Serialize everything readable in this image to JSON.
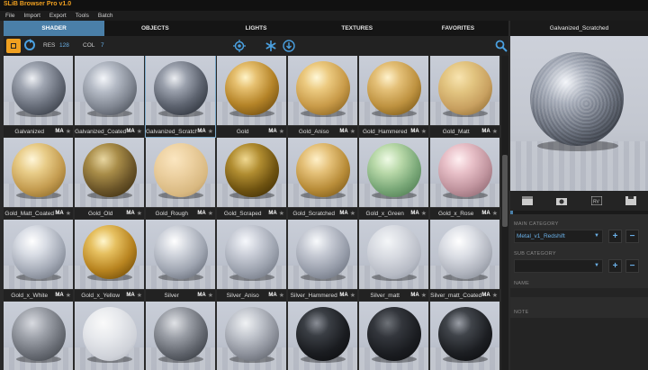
{
  "app": {
    "title": "SLiB Browser Pro v1.0"
  },
  "menu": [
    "File",
    "Import",
    "Export",
    "Tools",
    "Batch"
  ],
  "tabs": [
    {
      "label": "SHADER",
      "active": true
    },
    {
      "label": "OBJECTS",
      "active": false
    },
    {
      "label": "LIGHTS",
      "active": false
    },
    {
      "label": "TEXTURES",
      "active": false
    },
    {
      "label": "FAVORITES",
      "active": false
    }
  ],
  "toolbar": {
    "res_label": "RES",
    "res_value": "128",
    "col_label": "COL",
    "col_value": "7"
  },
  "tag": "MA",
  "colors": {
    "accent": "#4a7fa8",
    "orange": "#f0a020",
    "blue_text": "#6ab0e8"
  },
  "icons": [
    "grid-icon",
    "refresh-icon",
    "target-icon",
    "snowflake-icon",
    "download-icon",
    "search-icon",
    "clapper-icon",
    "camera-icon",
    "rv-icon",
    "save-icon"
  ],
  "shaders": [
    {
      "name": "Galvanized",
      "mat": "galv"
    },
    {
      "name": "Galvanized_Coated",
      "mat": "galv2"
    },
    {
      "name": "Galvanized_Scratched",
      "mat": "galv3",
      "selected": true
    },
    {
      "name": "Gold",
      "mat": "gold"
    },
    {
      "name": "Gold_Aniso",
      "mat": "goldaniso"
    },
    {
      "name": "Gold_Hammered",
      "mat": "goldham"
    },
    {
      "name": "Gold_Matt",
      "mat": "goldmatt"
    },
    {
      "name": "Gold_Matt_Coated",
      "mat": "goldmattc"
    },
    {
      "name": "Gold_Old",
      "mat": "goldold"
    },
    {
      "name": "Gold_Rough",
      "mat": "goldrough"
    },
    {
      "name": "Gold_Scraped",
      "mat": "goldscr"
    },
    {
      "name": "Gold_Scratched",
      "mat": "goldscr2"
    },
    {
      "name": "Gold_x_Green",
      "mat": "green"
    },
    {
      "name": "Gold_x_Rose",
      "mat": "rose"
    },
    {
      "name": "Gold_x_White",
      "mat": "white"
    },
    {
      "name": "Gold_x_Yellow",
      "mat": "yellow"
    },
    {
      "name": "Silver",
      "mat": "silver"
    },
    {
      "name": "Silver_Aniso",
      "mat": "silvaniso"
    },
    {
      "name": "Silver_Hammered",
      "mat": "silvham"
    },
    {
      "name": "Silver_matt",
      "mat": "silvmatt"
    },
    {
      "name": "Silver_matt_Coated",
      "mat": "silvmattc"
    },
    {
      "name": "",
      "mat": "stone"
    },
    {
      "name": "",
      "mat": "chalk"
    },
    {
      "name": "",
      "mat": "speckle"
    },
    {
      "name": "",
      "mat": "speckle2"
    },
    {
      "name": "",
      "mat": "black"
    },
    {
      "name": "",
      "mat": "black2"
    },
    {
      "name": "",
      "mat": "black3"
    }
  ],
  "preview": {
    "title": "Galvanized_Scratched"
  },
  "main_category": {
    "label": "MAIN CATEGORY",
    "value": "Metal_v1_Redshift"
  },
  "sub_category": {
    "label": "SUB CATEGORY",
    "value": ""
  },
  "name_label": "NAME",
  "note_label": "NOTE"
}
